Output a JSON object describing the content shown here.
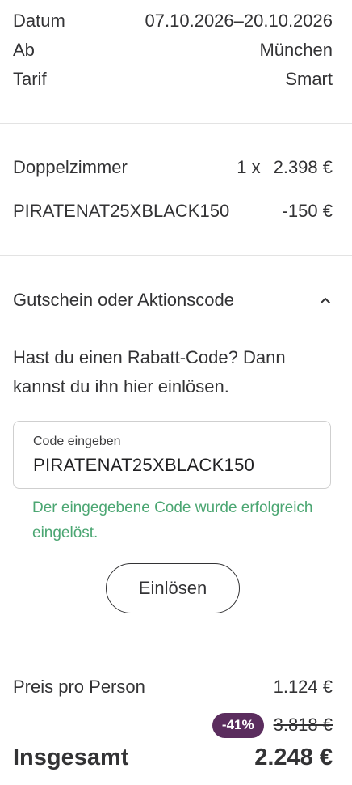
{
  "trip": {
    "date_label": "Datum",
    "date_value": "07.10.2026–20.10.2026",
    "from_label": "Ab",
    "from_value": "München",
    "tariff_label": "Tarif",
    "tariff_value": "Smart"
  },
  "items": [
    {
      "label": "Doppelzimmer",
      "qty": "1 x",
      "price": "2.398 €"
    },
    {
      "label": "PIRATENAT25XBLACK150",
      "qty": "",
      "price": "-150 €"
    }
  ],
  "voucher": {
    "header": "Gutschein oder Aktionscode",
    "expanded_icon": "chevron-up-icon",
    "hint": "Hast du einen Rabatt-Code? Dann kannst du ihn hier einlösen.",
    "field_label": "Code eingeben",
    "field_value": "PIRATENAT25XBLACK150",
    "success_message": "Der eingegebene Code wurde erfolgreich eingelöst.",
    "redeem_label": "Einlösen"
  },
  "summary": {
    "per_person_label": "Preis pro Person",
    "per_person_value": "1.124 €",
    "discount_badge": "-41%",
    "original_price": "3.818 €",
    "total_label": "Insgesamt",
    "total_value": "2.248 €"
  },
  "colors": {
    "text": "#333335",
    "success": "#4ba672",
    "badge": "#5b2d5e",
    "divider": "#e3e3e3"
  }
}
